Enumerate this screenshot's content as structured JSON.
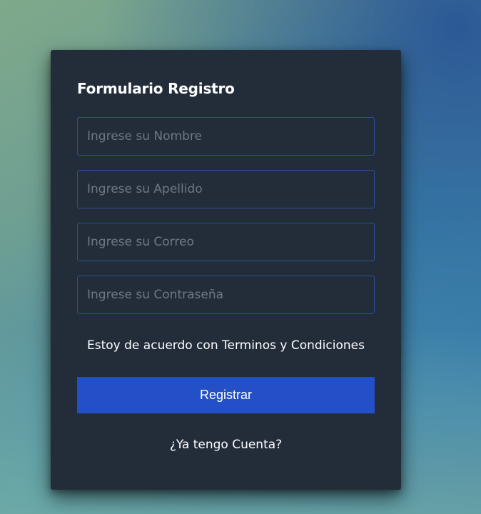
{
  "form": {
    "title": "Formulario Registro",
    "fields": [
      {
        "name": "nombre",
        "placeholder": "Ingrese su Nombre",
        "value": ""
      },
      {
        "name": "apellido",
        "placeholder": "Ingrese su Apellido",
        "value": ""
      },
      {
        "name": "correo",
        "placeholder": "Ingrese su Correo",
        "value": ""
      },
      {
        "name": "contrasena",
        "placeholder": "Ingrese su Contraseña",
        "value": ""
      }
    ],
    "terms_text": "Estoy de acuerdo con Terminos y Condiciones",
    "submit_label": "Registrar",
    "account_link": "¿Ya tengo Cuenta?"
  },
  "colors": {
    "card_background": "#232d3a",
    "input_border": "#2b4f99",
    "button_background": "#2350c7",
    "text": "#ffffff"
  }
}
